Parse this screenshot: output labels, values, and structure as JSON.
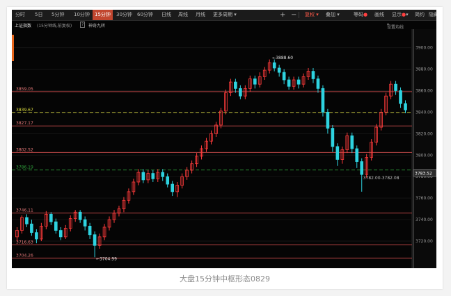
{
  "toolbar": {
    "periods": [
      "分时",
      "5日",
      "5分钟",
      "10分钟",
      "15分钟",
      "30分钟",
      "60分钟",
      "日线",
      "周线",
      "月线",
      "更多周期"
    ],
    "active_period": "15分钟",
    "plus": "+",
    "minus": "−",
    "right_items": [
      "复权",
      "叠加",
      "等码",
      "画线",
      "显示",
      "简约",
      "隐藏"
    ]
  },
  "infobar": {
    "index_name": "上证指数",
    "period_info": "(15分钟线,前复权)",
    "help": "?",
    "indicator": "神奇九转",
    "settings": "设置均线"
  },
  "caption": "大盘15分钟中枢形态0829",
  "colors": {
    "up": "#ff3b3b",
    "down": "#2ed3e0",
    "bg": "#050505",
    "level_line": "#d45050",
    "green_level": "#2fa33c"
  },
  "chart_data": {
    "type": "candlestick",
    "ylim": [
      3700,
      3912
    ],
    "y_ticks": [
      "3900.00",
      "3880.00",
      "3860.00",
      "3840.00",
      "3820.00",
      "3800.00",
      "3780.00",
      "3760.00",
      "3740.00",
      "3720.00"
    ],
    "current_price": "3783.52",
    "levels": [
      {
        "value": 3859.05,
        "label": "3859.05",
        "color": "#d45050"
      },
      {
        "value": 3839.67,
        "label": "3839.67",
        "color": "#e0e040",
        "dashed": true
      },
      {
        "value": 3827.17,
        "label": "3827.17",
        "color": "#d45050"
      },
      {
        "value": 3802.52,
        "label": "3802.52",
        "color": "#d45050"
      },
      {
        "value": 3786.19,
        "label": "3786.19",
        "color": "#2fa33c",
        "dashed": true
      },
      {
        "value": 3746.11,
        "label": "3746.11",
        "color": "#d45050"
      },
      {
        "value": 3716.63,
        "label": "3716.63",
        "color": "#d45050"
      },
      {
        "value": 3704.26,
        "label": "3704.26",
        "color": "#d45050"
      }
    ],
    "annotations": [
      {
        "text": "3888.60",
        "value": 3888.6
      },
      {
        "text": "3704.99",
        "value": 3704.99
      },
      {
        "text": "3782.00-3782.08",
        "value": 3782.0
      }
    ],
    "candles": [
      [
        3724,
        3730,
        3720,
        3733
      ],
      [
        3730,
        3742,
        3727,
        3744
      ],
      [
        3742,
        3736,
        3733,
        3745
      ],
      [
        3736,
        3728,
        3725,
        3740
      ],
      [
        3728,
        3722,
        3718,
        3731
      ],
      [
        3722,
        3734,
        3720,
        3737
      ],
      [
        3734,
        3745,
        3731,
        3748
      ],
      [
        3745,
        3738,
        3735,
        3747
      ],
      [
        3738,
        3730,
        3727,
        3741
      ],
      [
        3730,
        3724,
        3721,
        3733
      ],
      [
        3724,
        3732,
        3722,
        3735
      ],
      [
        3732,
        3741,
        3729,
        3744
      ],
      [
        3741,
        3747,
        3738,
        3749
      ],
      [
        3747,
        3740,
        3737,
        3749
      ],
      [
        3740,
        3734,
        3730,
        3743
      ],
      [
        3734,
        3726,
        3722,
        3737
      ],
      [
        3726,
        3716,
        3705,
        3729
      ],
      [
        3716,
        3724,
        3713,
        3727
      ],
      [
        3724,
        3733,
        3721,
        3736
      ],
      [
        3733,
        3740,
        3730,
        3743
      ],
      [
        3740,
        3746,
        3737,
        3749
      ],
      [
        3746,
        3750,
        3743,
        3753
      ],
      [
        3750,
        3758,
        3747,
        3761
      ],
      [
        3758,
        3766,
        3755,
        3769
      ],
      [
        3766,
        3775,
        3763,
        3778
      ],
      [
        3775,
        3784,
        3772,
        3787
      ],
      [
        3784,
        3777,
        3774,
        3787
      ],
      [
        3777,
        3783,
        3774,
        3786
      ],
      [
        3783,
        3778,
        3775,
        3786
      ],
      [
        3778,
        3784,
        3775,
        3787
      ],
      [
        3784,
        3780,
        3776,
        3787
      ],
      [
        3780,
        3773,
        3770,
        3783
      ],
      [
        3773,
        3766,
        3762,
        3776
      ],
      [
        3766,
        3772,
        3761,
        3775
      ],
      [
        3772,
        3780,
        3769,
        3783
      ],
      [
        3780,
        3786,
        3777,
        3789
      ],
      [
        3786,
        3792,
        3783,
        3795
      ],
      [
        3792,
        3799,
        3789,
        3802
      ],
      [
        3799,
        3806,
        3796,
        3809
      ],
      [
        3806,
        3813,
        3803,
        3816
      ],
      [
        3813,
        3820,
        3810,
        3823
      ],
      [
        3820,
        3828,
        3817,
        3831
      ],
      [
        3828,
        3841,
        3825,
        3844
      ],
      [
        3841,
        3858,
        3838,
        3861
      ],
      [
        3858,
        3868,
        3855,
        3871
      ],
      [
        3868,
        3862,
        3858,
        3871
      ],
      [
        3862,
        3855,
        3852,
        3865
      ],
      [
        3855,
        3862,
        3852,
        3865
      ],
      [
        3862,
        3871,
        3859,
        3874
      ],
      [
        3871,
        3866,
        3862,
        3874
      ],
      [
        3866,
        3873,
        3863,
        3877
      ],
      [
        3873,
        3879,
        3870,
        3882
      ],
      [
        3879,
        3886,
        3876,
        3889
      ],
      [
        3886,
        3881,
        3878,
        3889
      ],
      [
        3881,
        3877,
        3873,
        3884
      ],
      [
        3877,
        3870,
        3866,
        3880
      ],
      [
        3870,
        3864,
        3861,
        3873
      ],
      [
        3864,
        3870,
        3861,
        3873
      ],
      [
        3870,
        3866,
        3862,
        3873
      ],
      [
        3866,
        3873,
        3863,
        3876
      ],
      [
        3873,
        3878,
        3870,
        3881
      ],
      [
        3878,
        3871,
        3867,
        3881
      ],
      [
        3871,
        3862,
        3858,
        3874
      ],
      [
        3862,
        3840,
        3836,
        3865
      ],
      [
        3840,
        3825,
        3820,
        3843
      ],
      [
        3825,
        3808,
        3803,
        3828
      ],
      [
        3808,
        3796,
        3790,
        3811
      ],
      [
        3796,
        3805,
        3792,
        3808
      ],
      [
        3805,
        3818,
        3802,
        3821
      ],
      [
        3818,
        3806,
        3802,
        3821
      ],
      [
        3806,
        3794,
        3788,
        3809
      ],
      [
        3794,
        3782,
        3766,
        3797
      ],
      [
        3782,
        3798,
        3779,
        3801
      ],
      [
        3798,
        3812,
        3795,
        3815
      ],
      [
        3812,
        3826,
        3809,
        3829
      ],
      [
        3826,
        3840,
        3823,
        3843
      ],
      [
        3840,
        3855,
        3837,
        3858
      ],
      [
        3855,
        3866,
        3852,
        3869
      ],
      [
        3866,
        3860,
        3856,
        3869
      ],
      [
        3860,
        3848,
        3844,
        3863
      ],
      [
        3848,
        3842,
        3839,
        3851
      ]
    ]
  }
}
